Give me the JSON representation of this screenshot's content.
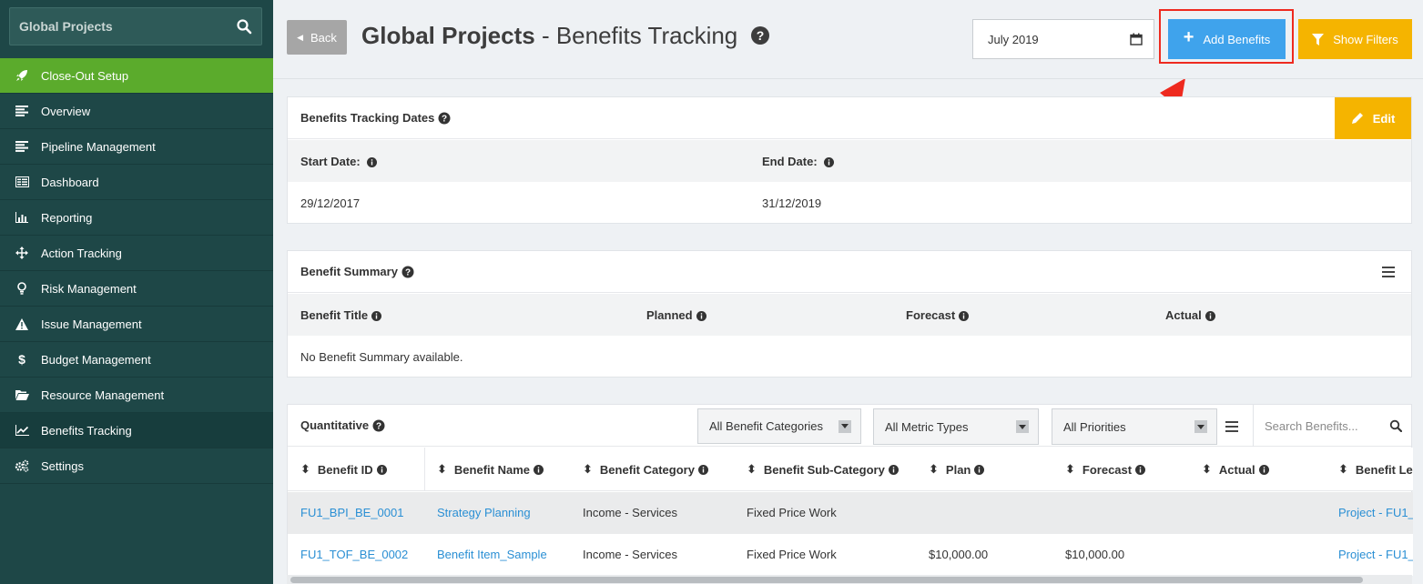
{
  "sidebar": {
    "search_title": "Global Projects",
    "items": [
      {
        "label": "Close-Out Setup",
        "icon": "rocket-icon"
      },
      {
        "label": "Overview",
        "icon": "list-icon"
      },
      {
        "label": "Pipeline Management",
        "icon": "list-icon"
      },
      {
        "label": "Dashboard",
        "icon": "dashboard-icon"
      },
      {
        "label": "Reporting",
        "icon": "bar-chart-icon"
      },
      {
        "label": "Action Tracking",
        "icon": "arrows-icon"
      },
      {
        "label": "Risk Management",
        "icon": "lightbulb-icon"
      },
      {
        "label": "Issue Management",
        "icon": "warning-icon"
      },
      {
        "label": "Budget Management",
        "icon": "dollar-icon"
      },
      {
        "label": "Resource Management",
        "icon": "folder-icon"
      },
      {
        "label": "Benefits Tracking",
        "icon": "line-chart-icon"
      },
      {
        "label": "Settings",
        "icon": "gears-icon"
      }
    ]
  },
  "header": {
    "back_label": "Back",
    "title_bold": "Global Projects",
    "title_rest": " - Benefits Tracking",
    "date_value": "July 2019",
    "add_label": "Add Benefits",
    "filter_label": "Show Filters"
  },
  "dates_panel": {
    "title": "Benefits Tracking Dates",
    "edit_label": "Edit",
    "start_label": "Start Date:",
    "end_label": "End Date:",
    "start_value": "29/12/2017",
    "end_value": "31/12/2019"
  },
  "summary_panel": {
    "title": "Benefit Summary",
    "columns": [
      "Benefit Title",
      "Planned",
      "Forecast",
      "Actual"
    ],
    "empty_message": "No Benefit Summary available."
  },
  "quant_panel": {
    "title": "Quantitative",
    "category_filter": "All Benefit Categories",
    "metric_filter": "All Metric Types",
    "priority_filter": "All Priorities",
    "search_placeholder": "Search Benefits...",
    "columns": [
      "Benefit ID",
      "Benefit Name",
      "Benefit Category",
      "Benefit Sub-Category",
      "Plan",
      "Forecast",
      "Actual",
      "Benefit Lev"
    ],
    "rows": [
      {
        "id": "FU1_BPI_BE_0001",
        "name": "Strategy Planning",
        "category": "Income - Services",
        "subcategory": "Fixed Price Work",
        "plan": "",
        "forecast": "",
        "actual": "",
        "level": "Project - FU1_"
      },
      {
        "id": "FU1_TOF_BE_0002",
        "name": "Benefit Item_Sample",
        "category": "Income - Services",
        "subcategory": "Fixed Price Work",
        "plan": "$10,000.00",
        "forecast": "$10,000.00",
        "actual": "",
        "level": "Project - FU1_"
      }
    ]
  },
  "colors": {
    "sidebar_bg": "#1e4747",
    "active_nav": "#5bab2c",
    "primary_button": "#3fa3ec",
    "warning_button": "#f5b400",
    "highlight": "#ee2a1f",
    "link": "#2a8fd4"
  }
}
